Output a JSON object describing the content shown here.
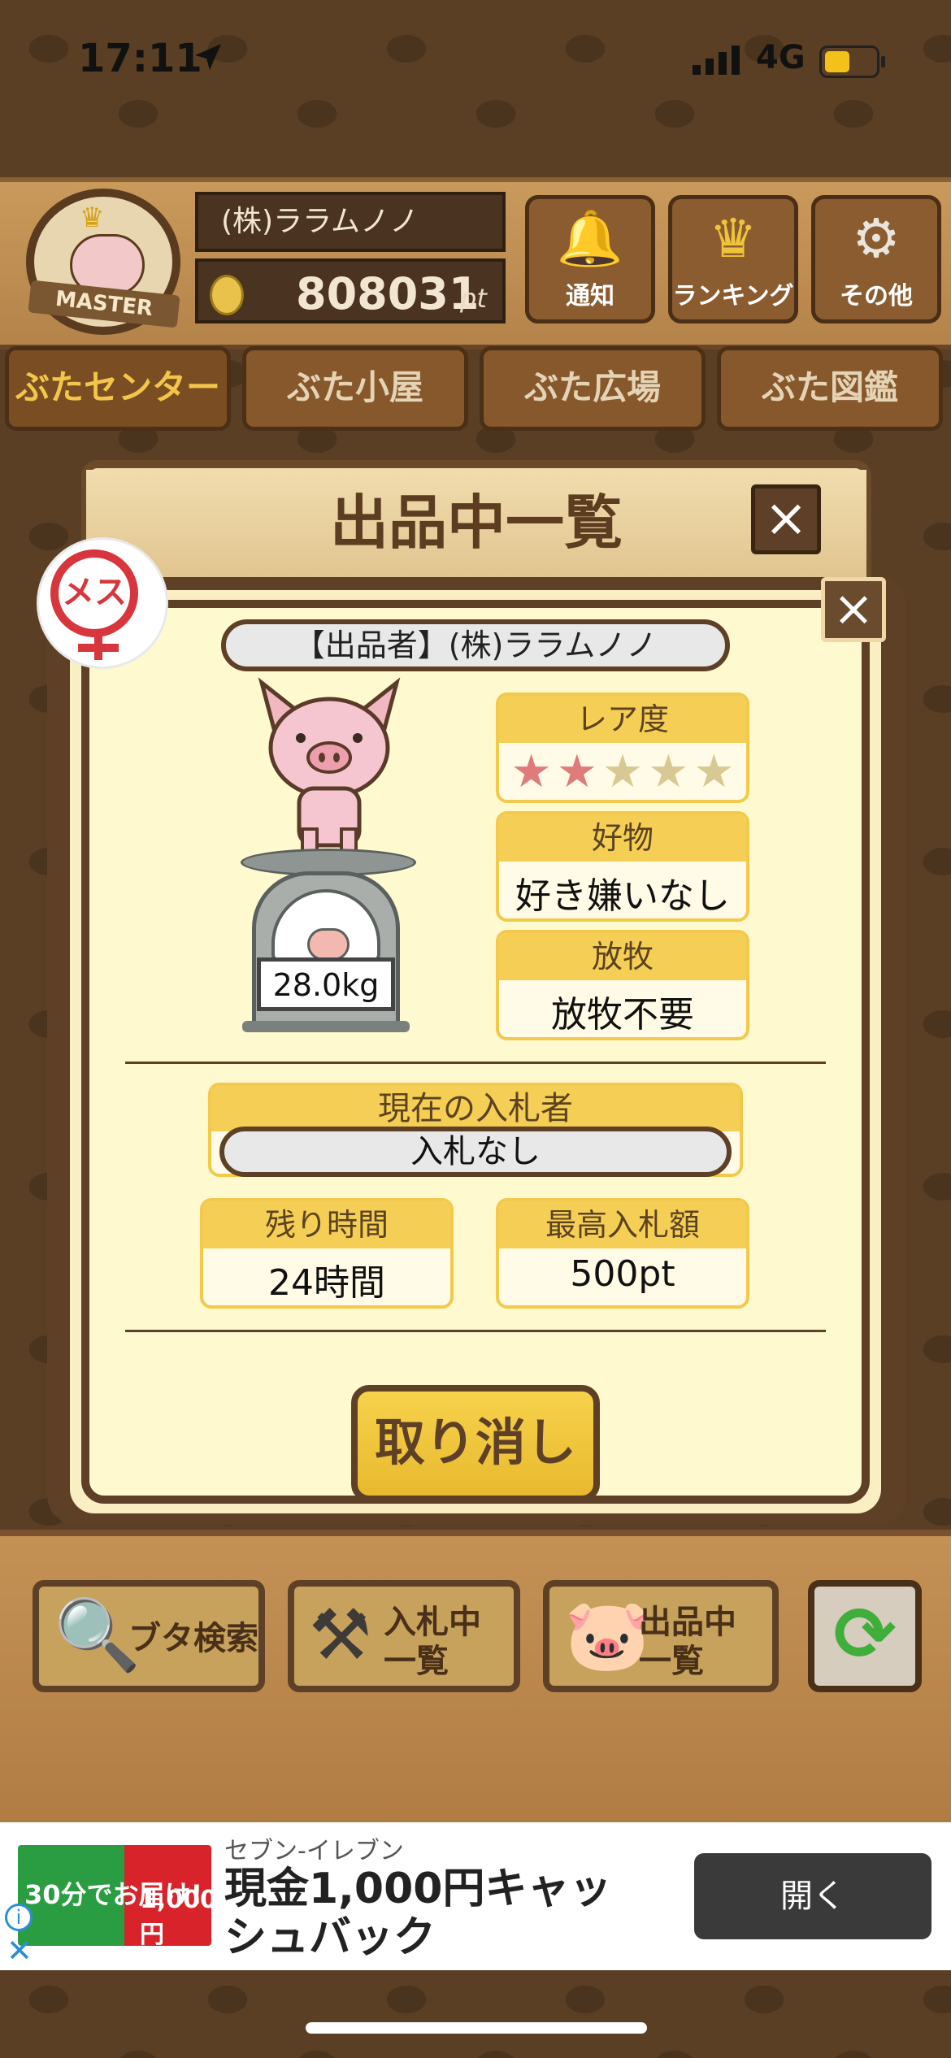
{
  "status_bar": {
    "time": "17:11",
    "network": "4G"
  },
  "header": {
    "badge": "MASTER",
    "player_name": "(株)ララムノノ",
    "points": "808031",
    "points_unit": "pt",
    "buttons": [
      {
        "label": "通知",
        "icon": "bell-icon"
      },
      {
        "label": "ランキング",
        "icon": "crown-icon"
      },
      {
        "label": "その他",
        "icon": "gear-icon"
      }
    ]
  },
  "nav_tabs": [
    "ぶたセンター",
    "ぶた小屋",
    "ぶた広場",
    "ぶた図鑑"
  ],
  "back_modal": {
    "title": "出品中一覧"
  },
  "detail": {
    "gender": "メス",
    "seller": "【出品者】(株)ララムノノ",
    "weight": "28.0kg",
    "rarity": {
      "label": "レア度",
      "stars_filled": 2,
      "stars_total": 5
    },
    "likes": {
      "label": "好物",
      "value": "好き嫌いなし"
    },
    "grazing": {
      "label": "放牧",
      "value": "放牧不要"
    },
    "current_bidder": {
      "label": "現在の入札者",
      "value": "入札なし"
    },
    "remaining_time": {
      "label": "残り時間",
      "value": "24時間"
    },
    "highest_bid": {
      "label": "最高入札額",
      "value": "500pt"
    },
    "cancel_label": "取り消し"
  },
  "bottom_bar": {
    "search": "ブタ検索",
    "bidding_list": "入札中\n一覧",
    "listing_list": "出品中\n一覧"
  },
  "ad": {
    "advertiser": "セブン-イレブン",
    "headline": "現金1,000円キャッシュバック",
    "open_button": "開く",
    "banner_left": "30分でお届け!",
    "banner_right": "1,000円"
  },
  "colors": {
    "accent_yellow": "#f5cf55",
    "wood_dark": "#5e4026",
    "female_red": "#d8363d"
  }
}
